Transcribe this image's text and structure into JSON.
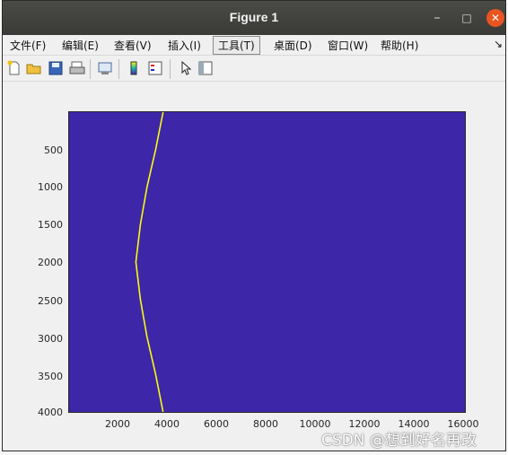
{
  "window": {
    "title": "Figure 1"
  },
  "menu": {
    "items": [
      {
        "label": "文件(F)"
      },
      {
        "label": "编辑(E)"
      },
      {
        "label": "查看(V)"
      },
      {
        "label": "插入(I)"
      },
      {
        "label": "工具(T)"
      },
      {
        "label": "桌面(D)"
      },
      {
        "label": "窗口(W)"
      },
      {
        "label": "帮助(H)"
      }
    ],
    "overflow": "↘"
  },
  "toolbar": {
    "icons": [
      "new-figure-icon",
      "open-file-icon",
      "save-icon",
      "print-icon",
      "link-plot-icon",
      "colorbar-icon",
      "legend-icon",
      "edit-plot-icon",
      "property-inspector-icon"
    ]
  },
  "colors": {
    "plot_bg": "#3e26a8",
    "curve": "#f9fb0e",
    "close_btn": "#e95420"
  },
  "chart_data": {
    "type": "heatmap",
    "x": {
      "ticks": [
        2000,
        4000,
        6000,
        8000,
        10000,
        12000,
        14000,
        16000
      ],
      "lim": [
        1,
        16000
      ]
    },
    "y": {
      "ticks": [
        500,
        1000,
        1500,
        2000,
        2500,
        3000,
        3500,
        4000
      ],
      "lim": [
        1,
        4000
      ],
      "reversed": true
    },
    "curve": {
      "description": "hyperbola-like bright trace",
      "points": [
        [
          3800,
          1
        ],
        [
          3500,
          500
        ],
        [
          3150,
          1000
        ],
        [
          2880,
          1500
        ],
        [
          2700,
          2000
        ],
        [
          2880,
          2500
        ],
        [
          3150,
          3000
        ],
        [
          3500,
          3500
        ],
        [
          3800,
          4000
        ]
      ]
    },
    "grid": false
  },
  "tick_labels": {
    "y": [
      "500",
      "1000",
      "1500",
      "2000",
      "2500",
      "3000",
      "3500",
      "4000"
    ],
    "x": [
      "2000",
      "4000",
      "6000",
      "8000",
      "10000",
      "12000",
      "14000",
      "16000"
    ]
  },
  "watermark": "CSDN @想到好名再改"
}
